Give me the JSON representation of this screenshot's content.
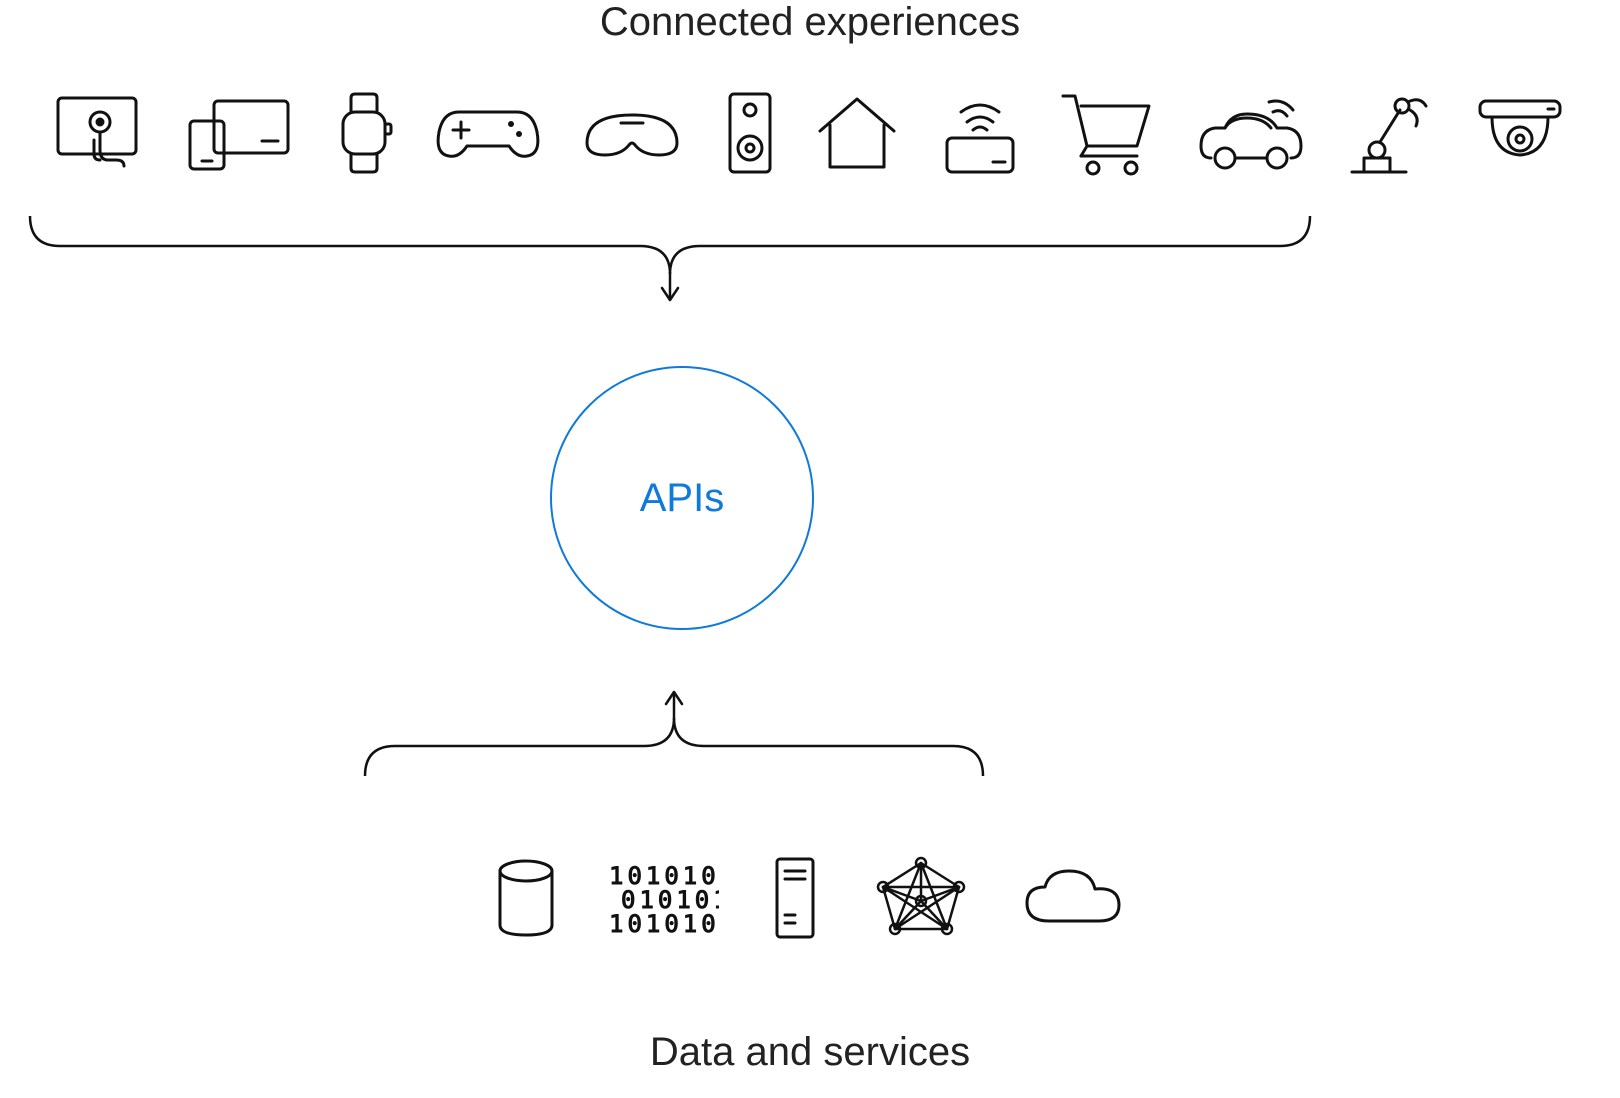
{
  "headings": {
    "top": "Connected experiences",
    "bottom": "Data and services"
  },
  "center": {
    "label": "APIs",
    "color": "#0f7adb"
  },
  "top_icons": [
    "touch-tablet-icon",
    "responsive-devices-icon",
    "smartwatch-icon",
    "game-controller-icon",
    "vr-headset-icon",
    "smart-speaker-icon",
    "home-icon",
    "contactless-card-icon",
    "shopping-cart-icon",
    "connected-car-icon",
    "robot-arm-icon",
    "security-camera-icon"
  ],
  "bottom_icons": [
    "database-icon",
    "binary-data-icon",
    "server-icon",
    "graph-network-icon",
    "cloud-icon"
  ]
}
